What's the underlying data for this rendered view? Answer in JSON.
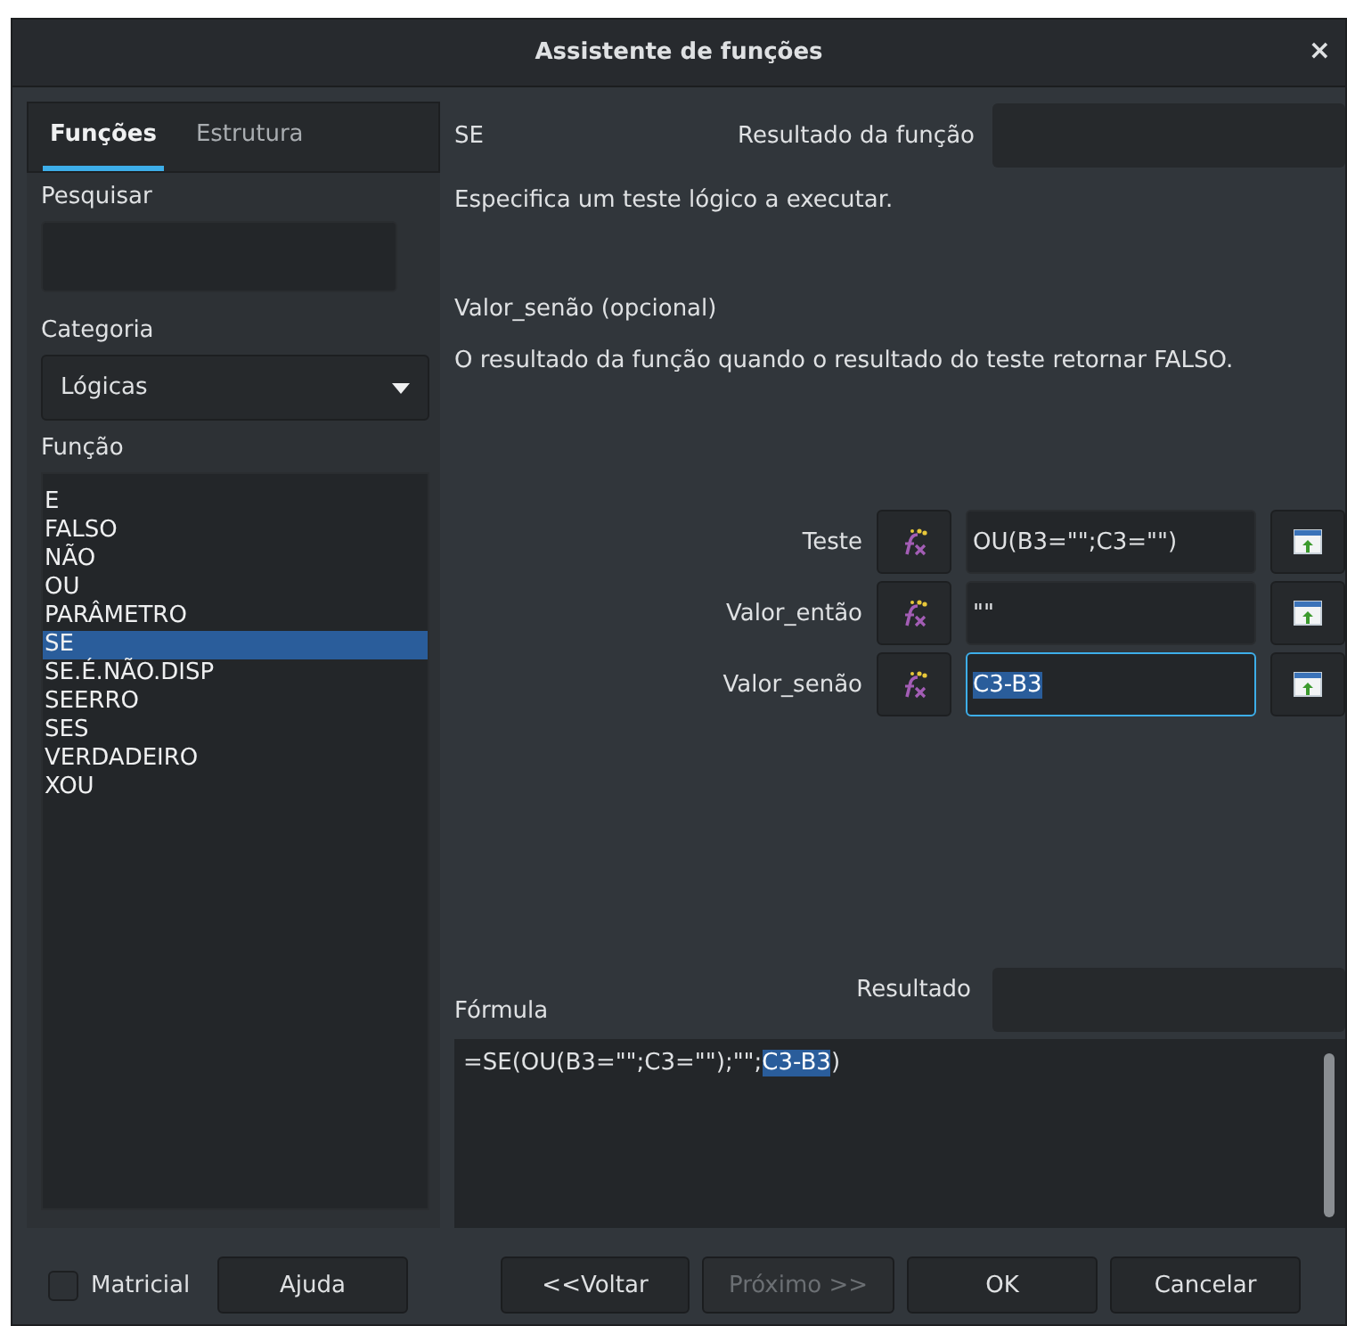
{
  "window": {
    "title": "Assistente de funções",
    "close": "×"
  },
  "tabs": [
    {
      "label": "Funções",
      "selected": true
    },
    {
      "label": "Estrutura",
      "selected": false
    }
  ],
  "search": {
    "label": "Pesquisar"
  },
  "category": {
    "label": "Categoria",
    "value": "Lógicas"
  },
  "functions": {
    "label": "Função",
    "items": [
      {
        "label": "E",
        "selected": false
      },
      {
        "label": "FALSO",
        "selected": false
      },
      {
        "label": "NÃO",
        "selected": false
      },
      {
        "label": "OU",
        "selected": false
      },
      {
        "label": "PARÂMETRO",
        "selected": false
      },
      {
        "label": "SE",
        "selected": true
      },
      {
        "label": "SE.É.NÃO.DISP",
        "selected": false
      },
      {
        "label": "SEERRO",
        "selected": false
      },
      {
        "label": "SES",
        "selected": false
      },
      {
        "label": "VERDADEIRO",
        "selected": false
      },
      {
        "label": "XOU",
        "selected": false
      }
    ]
  },
  "function_name": "SE",
  "function_result": {
    "label": "Resultado da função"
  },
  "description": "Especifica um teste lógico a executar.",
  "argument_name": "Valor_senão (opcional)",
  "argument_description": "O resultado da função quando o resultado do teste retornar FALSO.",
  "arguments": [
    {
      "label": "Teste",
      "value": "OU(B3=\"\";C3=\"\")",
      "selected": false
    },
    {
      "label": "Valor_então",
      "value": "\"\"",
      "selected": false
    },
    {
      "label": "Valor_senão",
      "value": "C3-B3",
      "selected": true
    }
  ],
  "formula": {
    "label": "Fórmula",
    "text_before": "=SE(OU(B3=\"\";C3=\"\");\"\";",
    "selection": "C3-B3",
    "text_after": ")"
  },
  "result": {
    "label": "Resultado"
  },
  "matricial": {
    "label": "Matricial",
    "checked": false
  },
  "buttons": [
    {
      "label": "Ajuda",
      "disabled": false
    },
    {
      "label": "<<Voltar",
      "disabled": false
    },
    {
      "label": "Próximo >>",
      "disabled": true
    },
    {
      "label": "OK",
      "disabled": false
    },
    {
      "label": "Cancelar",
      "disabled": false
    }
  ]
}
